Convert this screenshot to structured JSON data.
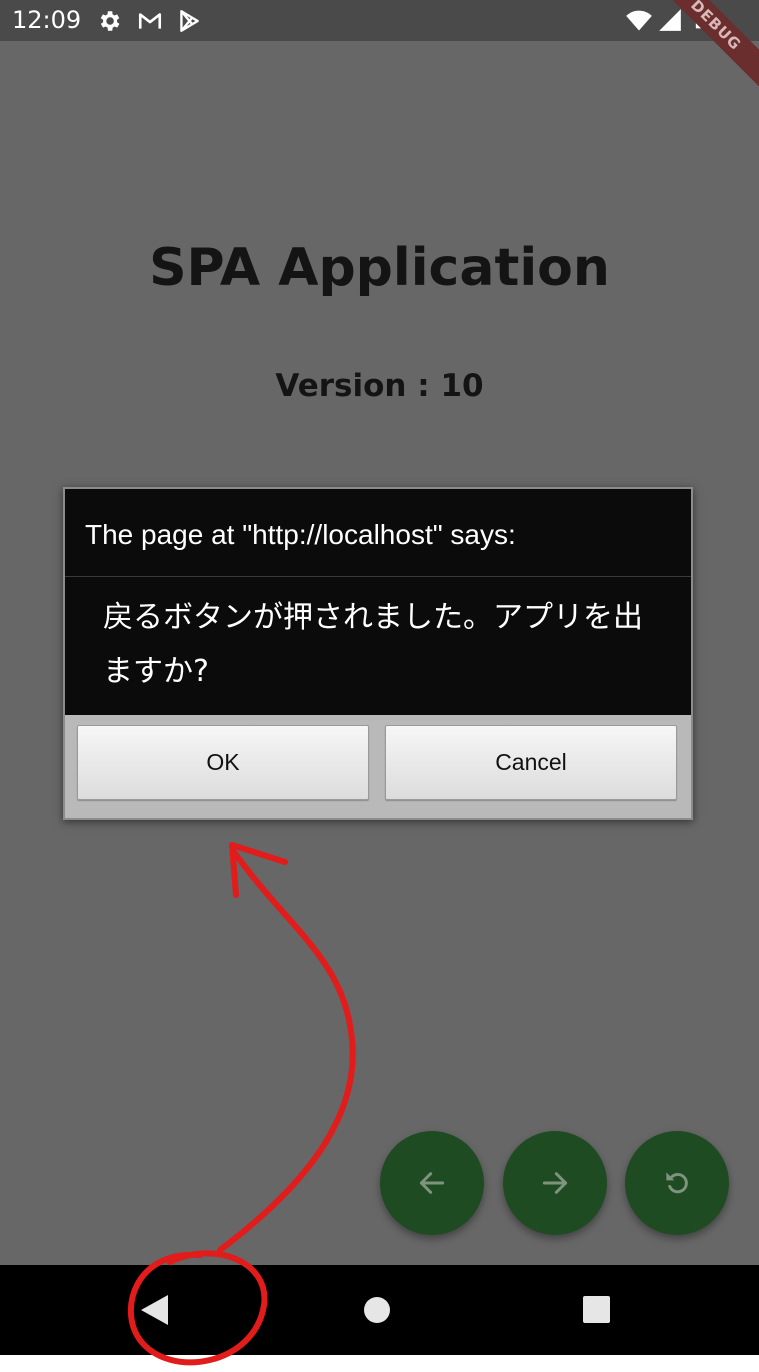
{
  "status_bar": {
    "time": "12:09",
    "icons": [
      "gear-icon",
      "gmail-icon",
      "play-store-icon"
    ],
    "right_icons": [
      "wifi-icon",
      "signal-icon",
      "battery-icon"
    ],
    "debug_banner": "DEBUG"
  },
  "page": {
    "title": "SPA Application",
    "version": "Version : 10"
  },
  "dialog": {
    "title": "The page at \"http://localhost\" says:",
    "message": "戻るボタンが押されました。アプリを出ますか?",
    "ok_label": "OK",
    "cancel_label": "Cancel"
  },
  "fabs": {
    "icons": [
      "arrow-left-icon",
      "arrow-right-icon",
      "refresh-icon"
    ],
    "color": "#1f4b22"
  },
  "nav_bar": {
    "icons": [
      "back-triangle-icon",
      "home-circle-icon",
      "recents-square-icon"
    ]
  },
  "annotation": {
    "color": "#e21b1b",
    "shapes": [
      "arrow-from-back-to-ok",
      "circle-around-back-button"
    ]
  }
}
